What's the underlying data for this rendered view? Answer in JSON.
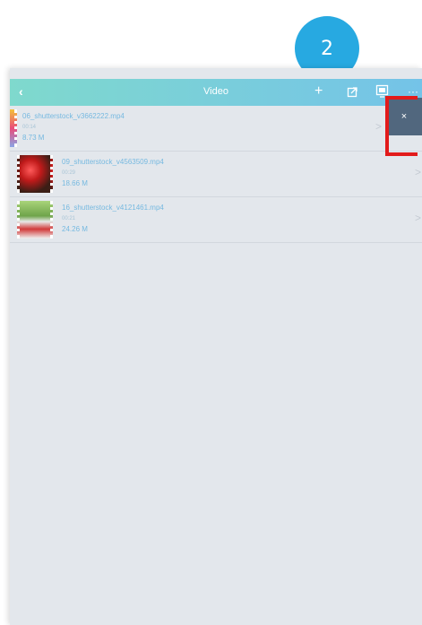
{
  "step_badge": "2",
  "nav": {
    "back_icon": "‹",
    "title": "Video",
    "add_icon": "+",
    "more_icon": "···"
  },
  "files": [
    {
      "name": "06_shutterstock_v3662222.mp4",
      "duration": "00:14",
      "size": "8.73 M"
    },
    {
      "name": "09_shutterstock_v4563509.mp4",
      "duration": "00:29",
      "size": "18.66 M"
    },
    {
      "name": "16_shutterstock_v4121461.mp4",
      "duration": "00:21",
      "size": "24.26 M"
    }
  ],
  "chevron": ">",
  "delete_label": "×",
  "colors": {
    "accent": "#27a9e1",
    "nav_gradient_start": "#7fd9cd",
    "nav_gradient_end": "#74c3e8",
    "delete_bg": "#51677e",
    "highlight": "#e21b1b"
  }
}
